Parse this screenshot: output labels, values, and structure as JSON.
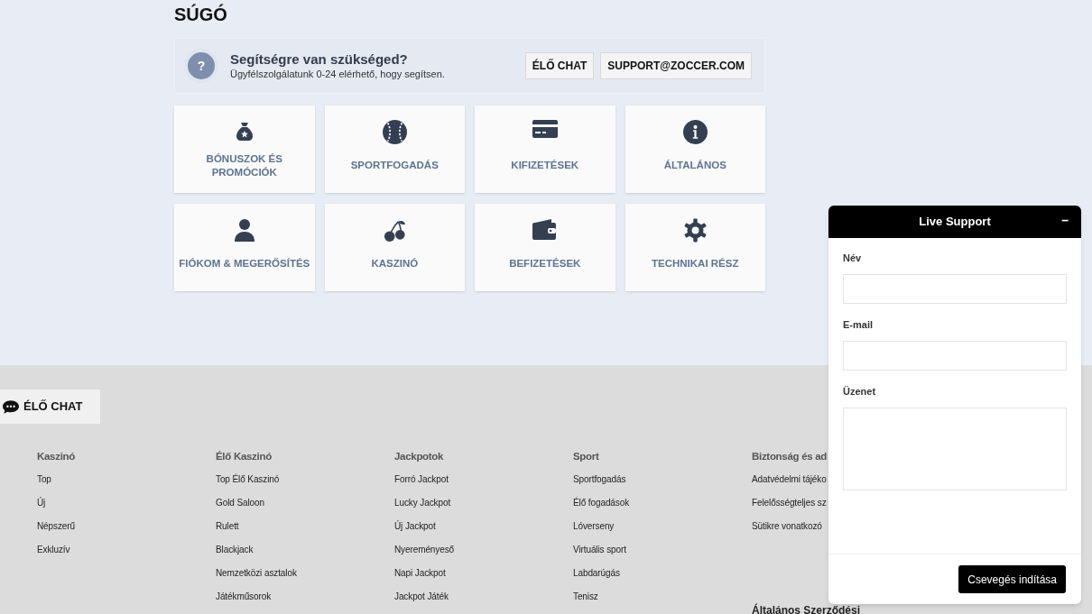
{
  "page_title": "SÚGÓ",
  "help_banner": {
    "icon": "?",
    "title": "Segítségre van szükséged?",
    "subtitle": "Ügyfélszolgálatunk 0-24 elérhető, hogy segítsen.",
    "buttons": [
      "ÉLŐ CHAT",
      "SUPPORT@ZOCCER.COM"
    ]
  },
  "categories": [
    {
      "label": "BÓNUSZOK ÉS\nPROMÓCIÓK"
    },
    {
      "label": "SPORTFOGADÁS"
    },
    {
      "label": "KIFIZETÉSEK"
    },
    {
      "label": "ÁLTALÁNOS"
    },
    {
      "label": "FIÓKOM & MEGERŐSÍTÉS"
    },
    {
      "label": "KASZINÓ"
    },
    {
      "label": "BEFIZETÉSEK"
    },
    {
      "label": "TECHNIKAI RÉSZ"
    }
  ],
  "live_chat_button": "ÉLŐ CHAT",
  "footer_columns": [
    {
      "title": "Kaszinó",
      "links": [
        "Top",
        "Új",
        "Népszerű",
        "Exkluzív"
      ]
    },
    {
      "title": "Élő Kaszinó",
      "links": [
        "Top Élő Kaszinó",
        "Gold Saloon",
        "Rulett",
        "Blackjack",
        "Nemzetközi asztalok",
        "Játékműsorok"
      ]
    },
    {
      "title": "Jackpotok",
      "links": [
        "Forró Jackpot",
        "Lucky Jackpot",
        "Új Jackpot",
        "Nyereményeső",
        "Napi Jackpot",
        "Jackpot Játék"
      ]
    },
    {
      "title": "Sport",
      "links": [
        "Sportfogadás",
        "Élő fogadások",
        "Lóverseny",
        "Virtuális sport",
        "Labdarúgás",
        "Tenisz"
      ]
    },
    {
      "title": "Biztonság és ad",
      "links": [
        "Adatvédelmi tájéko",
        "Felelősségteljes sz",
        "Sütikre vonatkozó"
      ],
      "extra_title": "Általános Szerződési"
    }
  ],
  "chat_widget": {
    "title": "Live Support",
    "minimize": "–",
    "fields": [
      {
        "label": "Név",
        "kind": "input"
      },
      {
        "label": "E-mail",
        "kind": "input"
      },
      {
        "label": "Üzenet",
        "kind": "textarea"
      }
    ],
    "submit": "Csevegés indítása"
  }
}
